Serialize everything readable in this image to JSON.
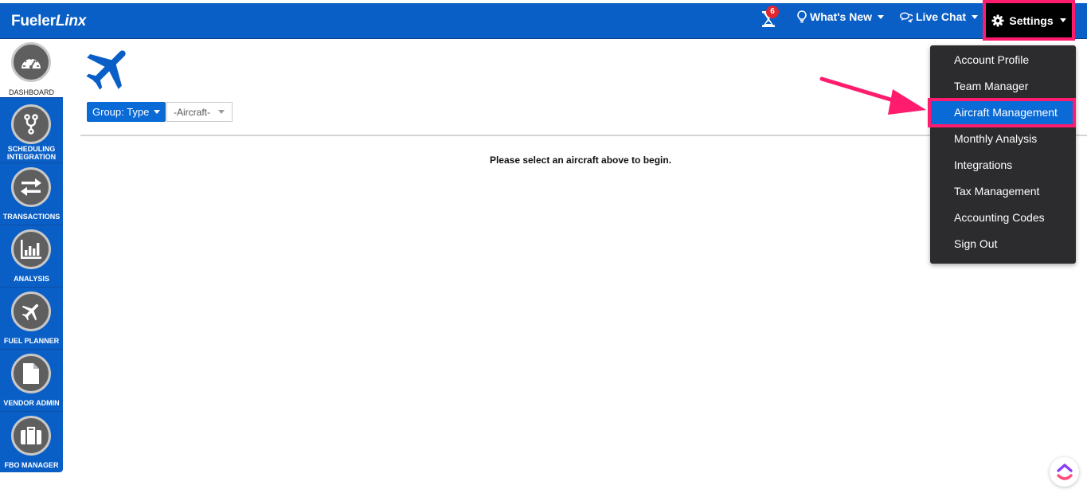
{
  "header": {
    "brand_main": "Fueler",
    "brand_accent": "Linx",
    "notification_count": "6",
    "whats_new_label": "What's New",
    "live_chat_label": "Live Chat",
    "settings_label": "Settings"
  },
  "sidebar": {
    "items": [
      {
        "label": "DASHBOARD",
        "icon": "speedometer-icon"
      },
      {
        "label_line1": "SCHEDULING",
        "label_line2": "INTEGRATION",
        "icon": "branch-icon"
      },
      {
        "label": "TRANSACTIONS",
        "icon": "exchange-icon"
      },
      {
        "label": "ANALYSIS",
        "icon": "bar-chart-icon"
      },
      {
        "label": "FUEL PLANNER",
        "icon": "airplane-icon"
      },
      {
        "label": "VENDOR ADMIN",
        "icon": "document-icon"
      },
      {
        "label": "FBO MANAGER",
        "icon": "briefcase-icon"
      }
    ]
  },
  "main": {
    "group_button_label": "Group: Type",
    "aircraft_select_value": "-Aircraft-",
    "empty_message": "Please select an aircraft above to begin."
  },
  "settings_menu": {
    "items": [
      {
        "label": "Account Profile"
      },
      {
        "label": "Team Manager"
      },
      {
        "label": "Aircraft Management",
        "active": true
      },
      {
        "label": "Monthly Analysis"
      },
      {
        "label": "Integrations"
      },
      {
        "label": "Tax Management"
      },
      {
        "label": "Accounting Codes"
      },
      {
        "label": "Sign Out"
      }
    ]
  },
  "colors": {
    "brand_blue": "#0a5fc6",
    "highlight": "#ff1b6d",
    "menu_bg": "#2c2c2e",
    "badge_red": "#e3262e"
  }
}
